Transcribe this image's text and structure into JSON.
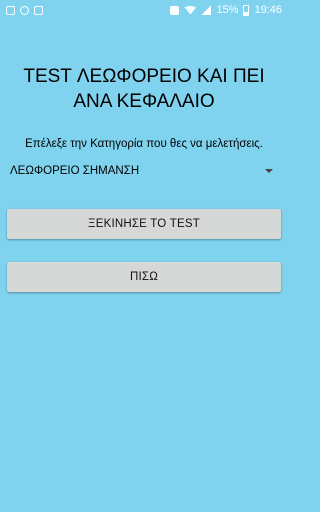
{
  "status_bar": {
    "battery": "15%",
    "time": "19:46",
    "left_icons": [
      "gallery-icon",
      "sync-icon",
      "sim-icon"
    ],
    "right_icons": [
      "nfc-icon",
      "wifi-icon",
      "signal-icon",
      "battery-icon"
    ]
  },
  "header": {
    "title": "TEST ΛΕΩΦΟΡΕΙΟ ΚΑΙ ΠΕΙ ΑΝΑ ΚΕΦΑΛΑΙΟ"
  },
  "form": {
    "prompt": "Επέλεξε την Κατηγορία που θες να μελετήσεις.",
    "category_selected": "ΛΕΩΦΟΡΕΙΟ ΣΗΜΑΝΣΗ"
  },
  "actions": {
    "start_label": "ΞΕΚΙΝΗΣΕ ΤΟ TEST",
    "back_label": "ΠΙΣΩ"
  },
  "colors": {
    "background": "#7fd3ee",
    "button": "#d6d7d7"
  }
}
